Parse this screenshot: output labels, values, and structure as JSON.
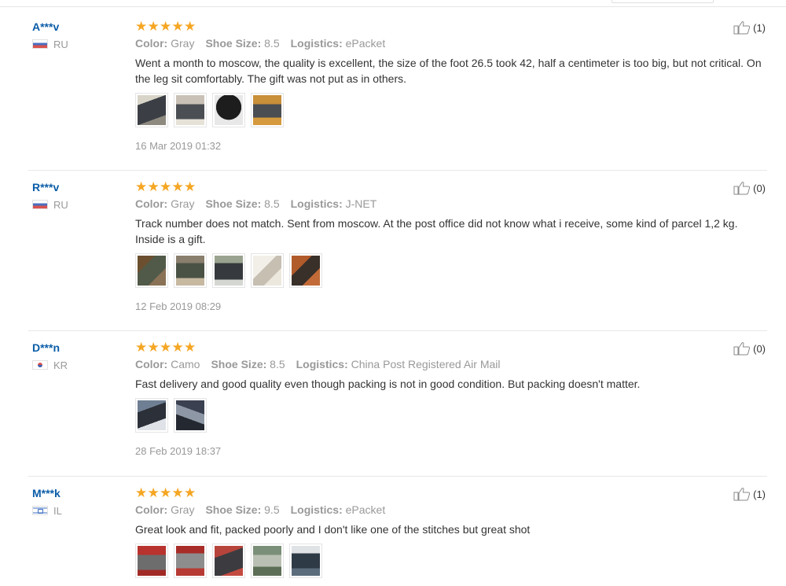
{
  "reviews": [
    {
      "buyer": "A***v",
      "country": "RU",
      "flag": "ru",
      "rating": 5,
      "color_label": "Color:",
      "color": "Gray",
      "size_label": "Shoe Size:",
      "size": "8.5",
      "logistics_label": "Logistics:",
      "logistics": "ePacket",
      "text": "Went a month to moscow, the quality is excellent, the size of the foot 26.5 took 42, half a centimeter is too big, but not critical. On the leg sit comfortably. The gift was not put as in others.",
      "photos": [
        "p-dark",
        "p-grey",
        "p-black",
        "p-orange"
      ],
      "date": "16 Mar 2019 01:32",
      "helpful": "(1)"
    },
    {
      "buyer": "R***v",
      "country": "RU",
      "flag": "ru",
      "rating": 5,
      "color_label": "Color:",
      "color": "Gray",
      "size_label": "Shoe Size:",
      "size": "8.5",
      "logistics_label": "Logistics:",
      "logistics": "J-NET",
      "text": "Track number does not match. Sent from moscow. At the post office did not know what i receive, some kind of parcel 1,2 kg. Inside is a gift.",
      "photos": [
        "p-brown",
        "p-olive",
        "p-shoe2",
        "p-pale",
        "p-rust"
      ],
      "date": "12 Feb 2019 08:29",
      "helpful": "(0)"
    },
    {
      "buyer": "D***n",
      "country": "KR",
      "flag": "kr",
      "rating": 5,
      "color_label": "Color:",
      "color": "Camo",
      "size_label": "Shoe Size:",
      "size": "8.5",
      "logistics_label": "Logistics:",
      "logistics": "China Post Registered Air Mail",
      "text": "Fast delivery and good quality even though packing is not in good condition. But packing doesn't matter.",
      "photos": [
        "p-camo",
        "p-camo2"
      ],
      "date": "28 Feb 2019 18:37",
      "helpful": "(0)"
    },
    {
      "buyer": "M***k",
      "country": "IL",
      "flag": "il",
      "rating": 5,
      "color_label": "Color:",
      "color": "Gray",
      "size_label": "Shoe Size:",
      "size": "9.5",
      "logistics_label": "Logistics:",
      "logistics": "ePacket",
      "text": "Great look and fit, packed poorly and I don't like one of the stitches but great shot",
      "photos": [
        "p-red",
        "p-red2",
        "p-red3",
        "p-green",
        "p-shoe"
      ],
      "date": "",
      "helpful": "(1)"
    }
  ],
  "colors": {
    "buyer_name": "#0b5da8",
    "star": "#f5a623",
    "muted": "#999999",
    "text": "#333333"
  },
  "icons": {
    "rating": "star-icon",
    "helpful": "thumbs-up-icon"
  }
}
